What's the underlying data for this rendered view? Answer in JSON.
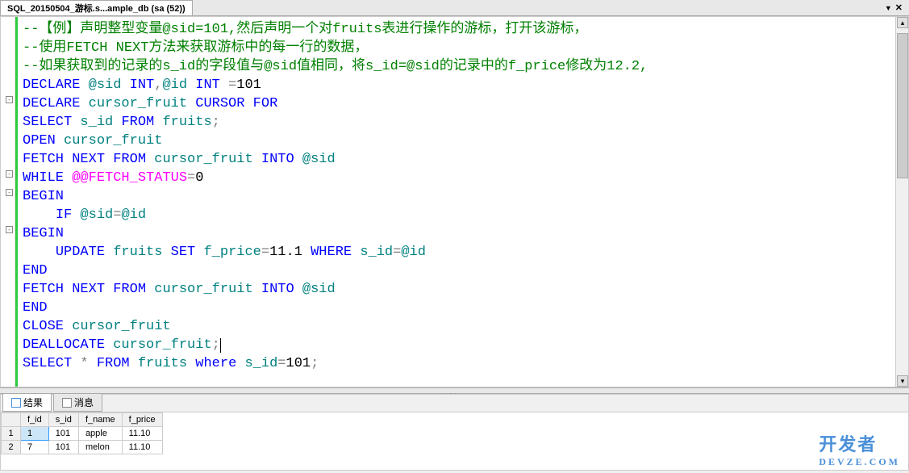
{
  "tab": {
    "title": "SQL_20150504_游标.s...ample_db (sa (52))"
  },
  "code": {
    "lines": [
      {
        "indent": "",
        "t": [
          {
            "c": "comment",
            "s": "--【例】声明整型变量@sid=101,然后声明一个对fruits表进行操作的游标，打开该游标，"
          }
        ]
      },
      {
        "indent": "",
        "t": [
          {
            "c": "comment",
            "s": "--使用FETCH NEXT方法来获取游标中的每一行的数据，"
          }
        ]
      },
      {
        "indent": "",
        "t": [
          {
            "c": "comment",
            "s": "--如果获取到的记录的s_id的字段值与@sid值相同，将s_id=@sid的记录中的f_price修改为12.2,"
          }
        ]
      },
      {
        "indent": "",
        "t": [
          {
            "c": "keyword",
            "s": "DECLARE"
          },
          {
            "c": "",
            "s": " "
          },
          {
            "c": "ident",
            "s": "@sid"
          },
          {
            "c": "",
            "s": " "
          },
          {
            "c": "keyword",
            "s": "INT"
          },
          {
            "c": "operator",
            "s": ","
          },
          {
            "c": "ident",
            "s": "@id"
          },
          {
            "c": "",
            "s": " "
          },
          {
            "c": "keyword",
            "s": "INT"
          },
          {
            "c": "",
            "s": " "
          },
          {
            "c": "operator",
            "s": "="
          },
          {
            "c": "",
            "s": "101"
          }
        ]
      },
      {
        "indent": "",
        "fold": true,
        "t": [
          {
            "c": "keyword",
            "s": "DECLARE"
          },
          {
            "c": "",
            "s": " "
          },
          {
            "c": "ident",
            "s": "cursor_fruit"
          },
          {
            "c": "",
            "s": " "
          },
          {
            "c": "keyword",
            "s": "CURSOR"
          },
          {
            "c": "",
            "s": " "
          },
          {
            "c": "keyword",
            "s": "FOR"
          }
        ]
      },
      {
        "indent": "",
        "t": [
          {
            "c": "keyword",
            "s": "SELECT"
          },
          {
            "c": "",
            "s": " "
          },
          {
            "c": "ident",
            "s": "s_id"
          },
          {
            "c": "",
            "s": " "
          },
          {
            "c": "keyword",
            "s": "FROM"
          },
          {
            "c": "",
            "s": " "
          },
          {
            "c": "ident",
            "s": "fruits"
          },
          {
            "c": "operator",
            "s": ";"
          }
        ]
      },
      {
        "indent": "",
        "t": [
          {
            "c": "keyword",
            "s": "OPEN"
          },
          {
            "c": "",
            "s": " "
          },
          {
            "c": "ident",
            "s": "cursor_fruit"
          }
        ]
      },
      {
        "indent": "",
        "t": [
          {
            "c": "keyword",
            "s": "FETCH"
          },
          {
            "c": "",
            "s": " "
          },
          {
            "c": "keyword",
            "s": "NEXT"
          },
          {
            "c": "",
            "s": " "
          },
          {
            "c": "keyword",
            "s": "FROM"
          },
          {
            "c": "",
            "s": " "
          },
          {
            "c": "ident",
            "s": "cursor_fruit"
          },
          {
            "c": "",
            "s": " "
          },
          {
            "c": "keyword",
            "s": "INTO"
          },
          {
            "c": "",
            "s": " "
          },
          {
            "c": "ident",
            "s": "@sid"
          }
        ]
      },
      {
        "indent": "",
        "fold": true,
        "t": [
          {
            "c": "keyword",
            "s": "WHILE"
          },
          {
            "c": "",
            "s": " "
          },
          {
            "c": "sysvar",
            "s": "@@FETCH_STATUS"
          },
          {
            "c": "operator",
            "s": "="
          },
          {
            "c": "",
            "s": "0"
          }
        ]
      },
      {
        "indent": "",
        "fold": true,
        "t": [
          {
            "c": "keyword",
            "s": "BEGIN"
          }
        ]
      },
      {
        "indent": "    ",
        "t": [
          {
            "c": "keyword",
            "s": "IF"
          },
          {
            "c": "",
            "s": " "
          },
          {
            "c": "ident",
            "s": "@sid"
          },
          {
            "c": "operator",
            "s": "="
          },
          {
            "c": "ident",
            "s": "@id"
          }
        ]
      },
      {
        "indent": "",
        "fold": true,
        "t": [
          {
            "c": "keyword",
            "s": "BEGIN"
          }
        ]
      },
      {
        "indent": "    ",
        "t": [
          {
            "c": "keyword",
            "s": "UPDATE"
          },
          {
            "c": "",
            "s": " "
          },
          {
            "c": "ident",
            "s": "fruits"
          },
          {
            "c": "",
            "s": " "
          },
          {
            "c": "keyword",
            "s": "SET"
          },
          {
            "c": "",
            "s": " "
          },
          {
            "c": "ident",
            "s": "f_price"
          },
          {
            "c": "operator",
            "s": "="
          },
          {
            "c": "",
            "s": "11.1 "
          },
          {
            "c": "keyword",
            "s": "WHERE"
          },
          {
            "c": "",
            "s": " "
          },
          {
            "c": "ident",
            "s": "s_id"
          },
          {
            "c": "operator",
            "s": "="
          },
          {
            "c": "ident",
            "s": "@id"
          }
        ]
      },
      {
        "indent": "",
        "t": [
          {
            "c": "keyword",
            "s": "END"
          }
        ]
      },
      {
        "indent": "",
        "t": [
          {
            "c": "keyword",
            "s": "FETCH"
          },
          {
            "c": "",
            "s": " "
          },
          {
            "c": "keyword",
            "s": "NEXT"
          },
          {
            "c": "",
            "s": " "
          },
          {
            "c": "keyword",
            "s": "FROM"
          },
          {
            "c": "",
            "s": " "
          },
          {
            "c": "ident",
            "s": "cursor_fruit"
          },
          {
            "c": "",
            "s": " "
          },
          {
            "c": "keyword",
            "s": "INTO"
          },
          {
            "c": "",
            "s": " "
          },
          {
            "c": "ident",
            "s": "@sid"
          }
        ]
      },
      {
        "indent": "",
        "t": [
          {
            "c": "keyword",
            "s": "END"
          }
        ]
      },
      {
        "indent": "",
        "t": [
          {
            "c": "keyword",
            "s": "CLOSE"
          },
          {
            "c": "",
            "s": " "
          },
          {
            "c": "ident",
            "s": "cursor_fruit"
          }
        ]
      },
      {
        "indent": "",
        "t": [
          {
            "c": "keyword",
            "s": "DEALLOCATE"
          },
          {
            "c": "",
            "s": " "
          },
          {
            "c": "ident",
            "s": "cursor_fruit"
          },
          {
            "c": "operator",
            "s": ";"
          }
        ],
        "caret": true
      },
      {
        "indent": "",
        "t": [
          {
            "c": "keyword",
            "s": "SELECT"
          },
          {
            "c": "",
            "s": " "
          },
          {
            "c": "operator",
            "s": "*"
          },
          {
            "c": "",
            "s": " "
          },
          {
            "c": "keyword",
            "s": "FROM"
          },
          {
            "c": "",
            "s": " "
          },
          {
            "c": "ident",
            "s": "fruits"
          },
          {
            "c": "",
            "s": " "
          },
          {
            "c": "keyword",
            "s": "where"
          },
          {
            "c": "",
            "s": " "
          },
          {
            "c": "ident",
            "s": "s_id"
          },
          {
            "c": "operator",
            "s": "="
          },
          {
            "c": "",
            "s": "101"
          },
          {
            "c": "operator",
            "s": ";"
          }
        ]
      }
    ]
  },
  "results": {
    "tabs": [
      {
        "label": "结果",
        "icon": "grid"
      },
      {
        "label": "消息",
        "icon": "msg"
      }
    ],
    "columns": [
      "f_id",
      "s_id",
      "f_name",
      "f_price"
    ],
    "rows": [
      {
        "n": "1",
        "cells": [
          "1",
          "101",
          "apple",
          "11.10"
        ]
      },
      {
        "n": "2",
        "cells": [
          "7",
          "101",
          "melon",
          "11.10"
        ]
      }
    ]
  },
  "watermark": {
    "main": "开发者",
    "sub": "DEVZE.COM"
  }
}
